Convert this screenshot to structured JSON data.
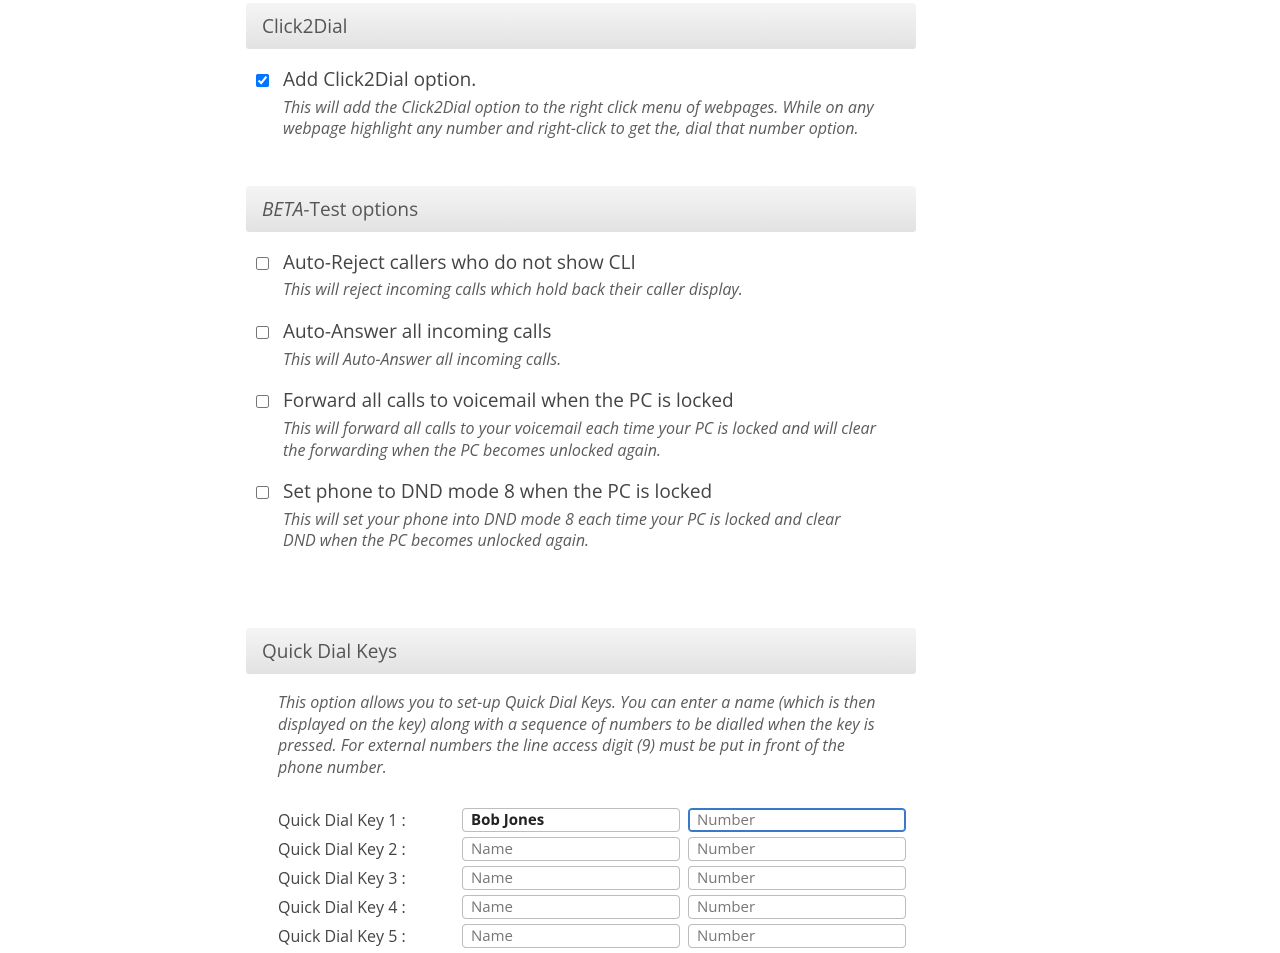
{
  "sections": {
    "click2dial": {
      "header": "Click2Dial",
      "option": {
        "title": "Add Click2Dial option.",
        "desc": "This will add the Click2Dial option to the right click menu of webpages. While on any webpage highlight any number and right-click to get the, dial that number option.",
        "checked": true
      }
    },
    "beta": {
      "header_prefix": "BETA",
      "header_suffix": "-Test options",
      "options": [
        {
          "title": "Auto-Reject callers who do not show CLI",
          "desc": "This will reject incoming calls which hold back their caller display."
        },
        {
          "title": "Auto-Answer all incoming calls",
          "desc": "This will Auto-Answer all incoming calls."
        },
        {
          "title": "Forward all calls to voicemail when the PC is locked",
          "desc": "This will forward all calls to your voicemail each time your PC is locked and will clear the forwarding when the PC becomes unlocked again."
        },
        {
          "title": "Set phone to DND mode 8 when the PC is locked",
          "desc": "This will set your phone into DND mode 8 each time your PC is locked and clear DND when the PC becomes unlocked again."
        }
      ]
    },
    "quickdial": {
      "header": "Quick Dial Keys",
      "desc": "This option allows you to set-up Quick Dial Keys. You can enter a name (which is then displayed on the key) along with a sequence of numbers to be dialled when the key is pressed. For external numbers the line access digit (9) must be put in front of the phone number.",
      "name_placeholder": "Name",
      "number_placeholder": "Number",
      "rows": [
        {
          "label": "Quick Dial Key 1 :",
          "name": "Bob Jones",
          "number": "",
          "bold": true,
          "focused": true
        },
        {
          "label": "Quick Dial Key 2 :",
          "name": "",
          "number": ""
        },
        {
          "label": "Quick Dial Key 3 :",
          "name": "",
          "number": ""
        },
        {
          "label": "Quick Dial Key 4 :",
          "name": "",
          "number": ""
        },
        {
          "label": "Quick Dial Key 5 :",
          "name": "",
          "number": ""
        }
      ]
    }
  }
}
